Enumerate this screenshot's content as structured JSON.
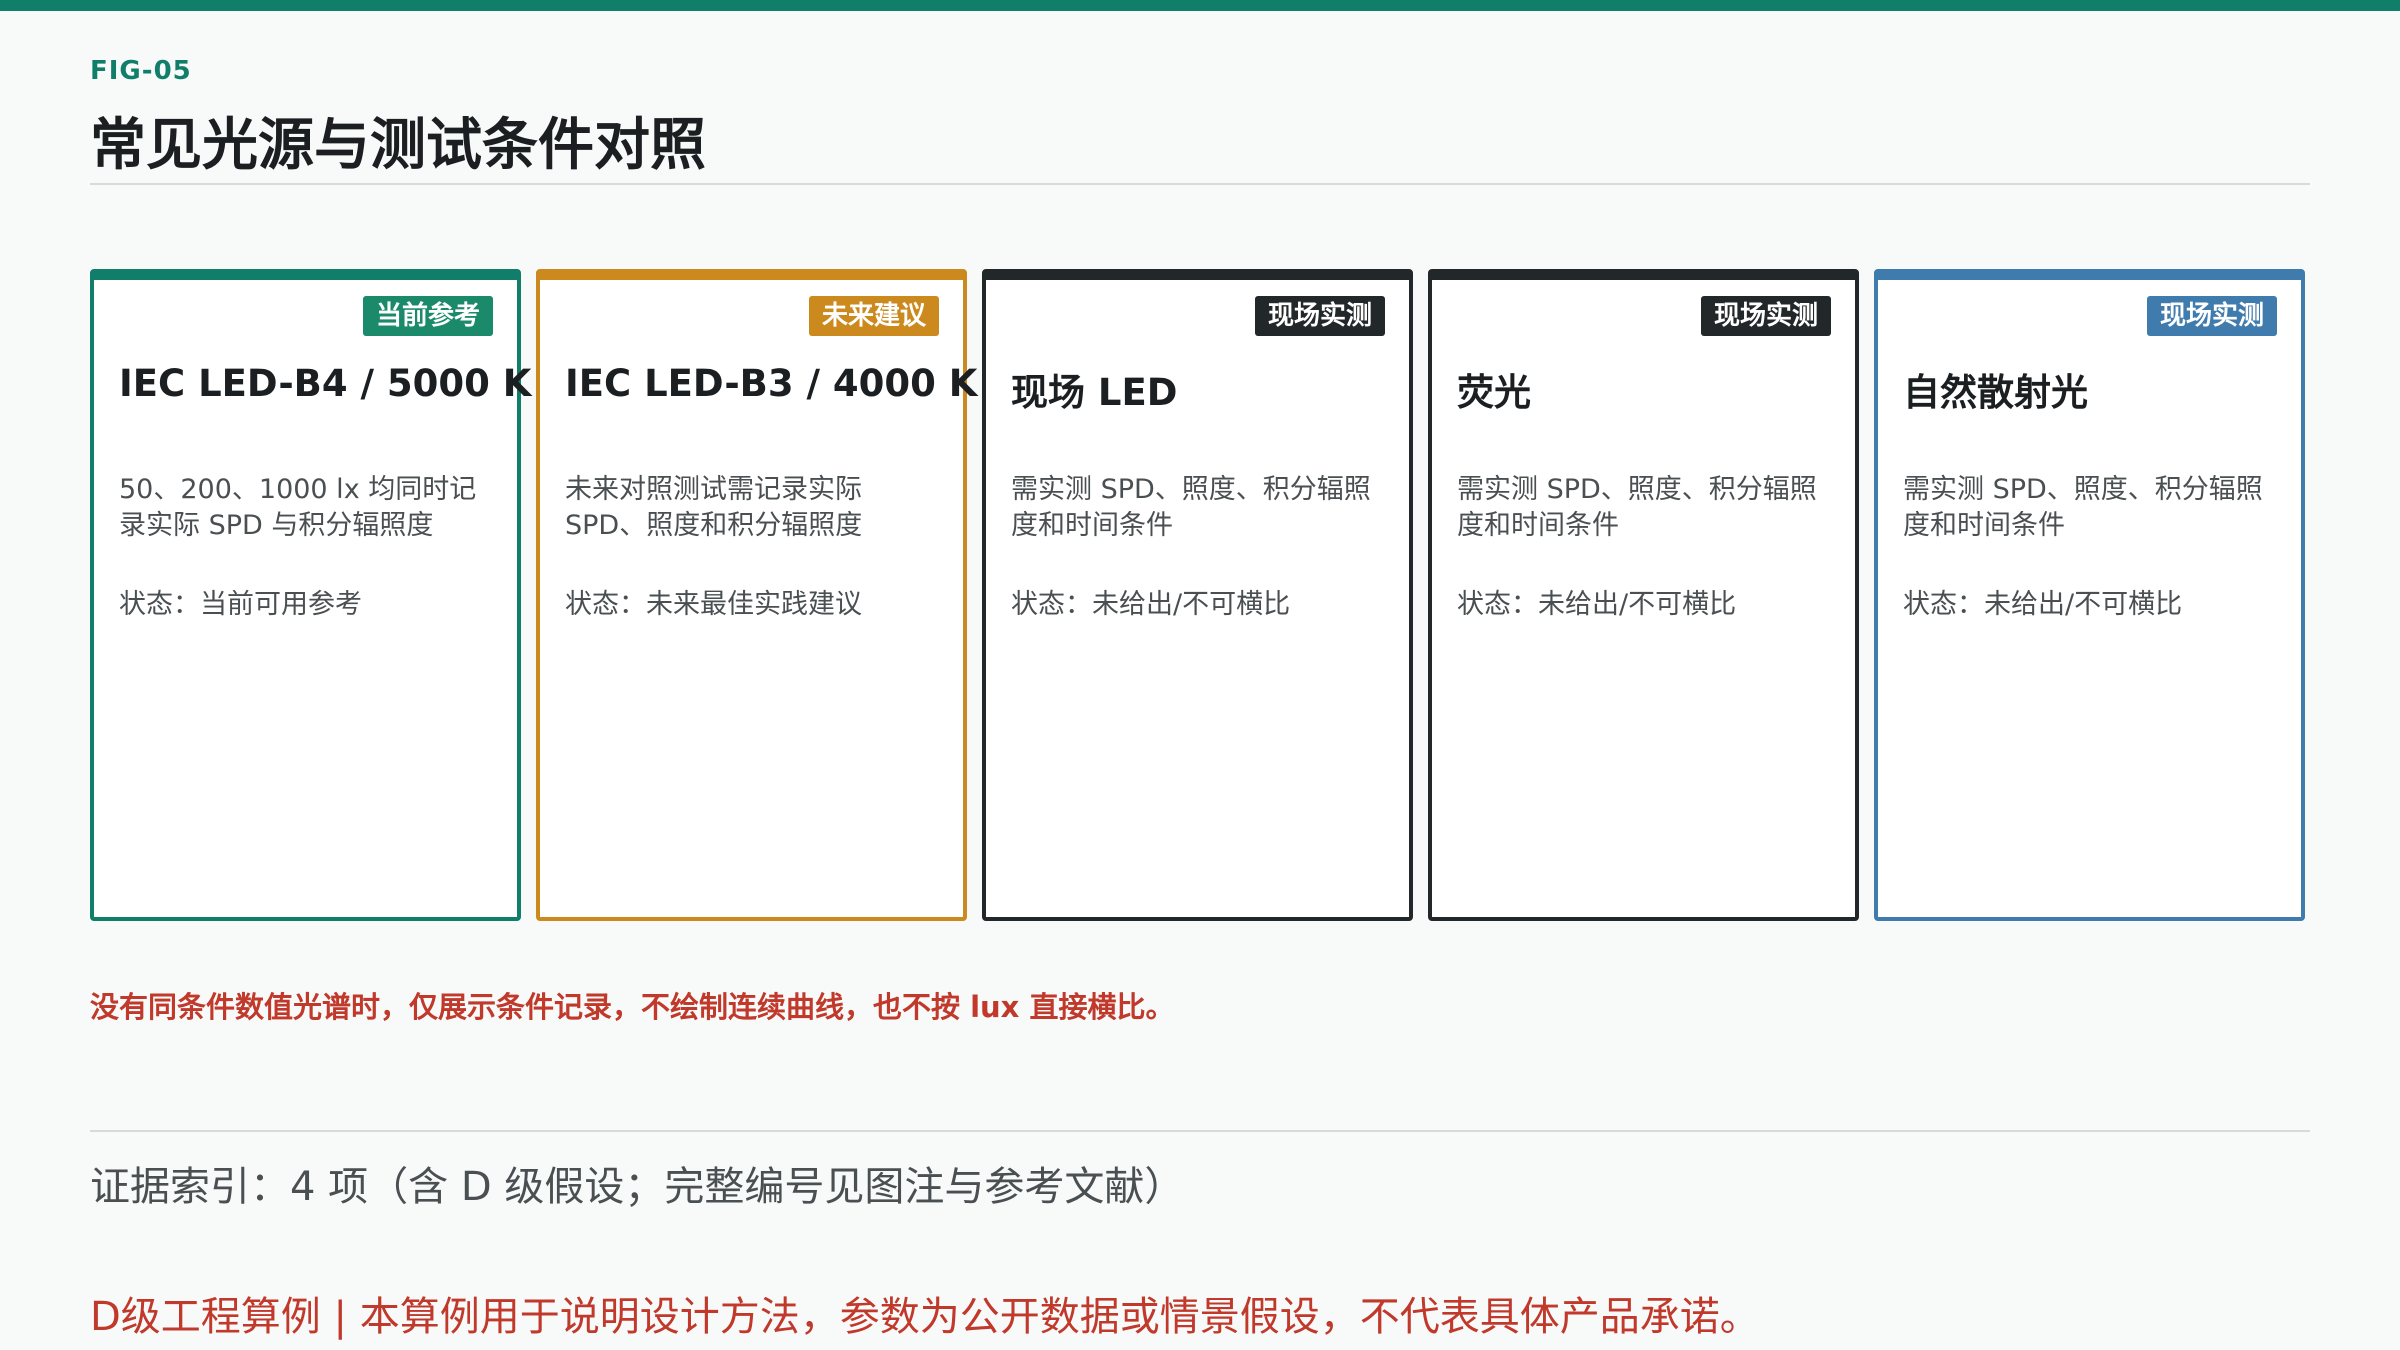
{
  "header": {
    "fig_label": "FIG-05",
    "title": "常见光源与测试条件对照"
  },
  "cards": [
    {
      "badge": "当前参考",
      "title": "IEC LED-B4 / 5000 K",
      "desc": "50、200、1000 lx 均同时记录实际 SPD 与积分辐照度",
      "status": "状态：当前可用参考",
      "border_color": "#117e6a",
      "badge_color": "#1b8a6b"
    },
    {
      "badge": "未来建议",
      "title": "IEC LED-B3 / 4000 K",
      "desc": "未来对照测试需记录实际 SPD、照度和积分辐照度",
      "status": "状态：未来最佳实践建议",
      "border_color": "#cc8a1e",
      "badge_color": "#cc8a1e"
    },
    {
      "badge": "现场实测",
      "title": "现场 LED",
      "desc": "需实测 SPD、照度、积分辐照度和时间条件",
      "status": "状态：未给出/不可横比",
      "border_color": "#22272a",
      "badge_color": "#22272a"
    },
    {
      "badge": "现场实测",
      "title": "荧光",
      "desc": "需实测 SPD、照度、积分辐照度和时间条件",
      "status": "状态：未给出/不可横比",
      "border_color": "#22272a",
      "badge_color": "#22272a"
    },
    {
      "badge": "现场实测",
      "title": "自然散射光",
      "desc": "需实测 SPD、照度、积分辐照度和时间条件",
      "status": "状态：未给出/不可横比",
      "border_color": "#3f7cad",
      "badge_color": "#3f7cad"
    }
  ],
  "note": "没有同条件数值光谱时，仅展示条件记录，不绘制连续曲线，也不按 lux 直接横比。",
  "footer": {
    "evidence": "证据索引：4 项（含 D 级假设；完整编号见图注与参考文献）",
    "disclaimer": "D级工程算例 | 本算例用于说明设计方法，参数为公开数据或情景假设，不代表具体产品承诺。"
  }
}
